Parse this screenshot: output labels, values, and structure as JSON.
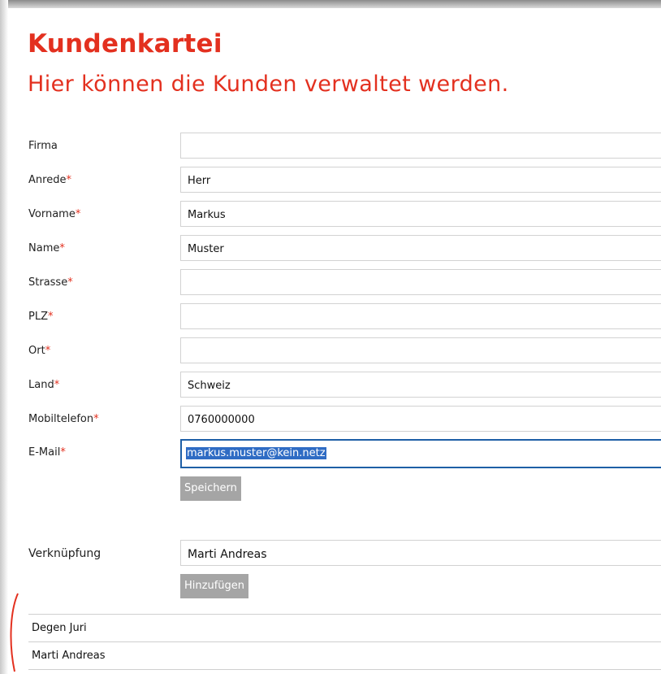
{
  "page": {
    "title": "Kundenkartei",
    "subtitle": "Hier können die Kunden verwaltet werden."
  },
  "form": {
    "fields": [
      {
        "label": "Firma",
        "required": false,
        "value": ""
      },
      {
        "label": "Anrede",
        "required": true,
        "value": "Herr"
      },
      {
        "label": "Vorname",
        "required": true,
        "value": "Markus"
      },
      {
        "label": "Name",
        "required": true,
        "value": "Muster"
      },
      {
        "label": "Strasse",
        "required": true,
        "value": ""
      },
      {
        "label": "PLZ",
        "required": true,
        "value": ""
      },
      {
        "label": "Ort",
        "required": true,
        "value": ""
      },
      {
        "label": "Land",
        "required": true,
        "value": "Schweiz"
      },
      {
        "label": "Mobiltelefon",
        "required": true,
        "value": "0760000000"
      },
      {
        "label": "E-Mail",
        "required": true,
        "value": "markus.muster@kein.netz"
      }
    ],
    "required_marker": "*",
    "save_label": "Speichern"
  },
  "link_section": {
    "label": "Verknüpfung",
    "value": "Marti Andreas",
    "add_label": "Hinzufügen",
    "items": [
      "Degen Juri",
      "Marti Andreas"
    ]
  },
  "colors": {
    "accent": "#e3301f",
    "button": "#a5a5a5",
    "focus_border": "#1e5fa6",
    "selection": "#2f6cc4"
  }
}
